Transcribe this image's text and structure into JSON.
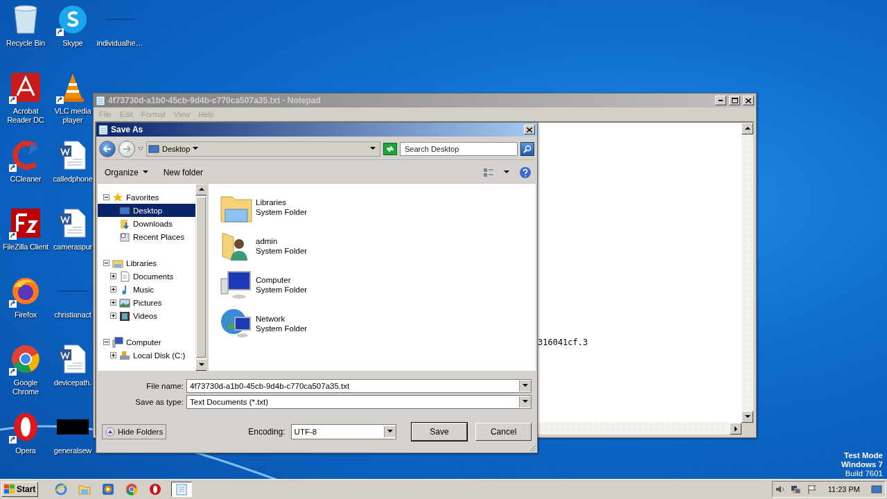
{
  "desktop_columns": [
    [
      {
        "label": "Recycle Bin",
        "kind": "recycle",
        "shortcut": false
      },
      {
        "label": "Acrobat Reader DC",
        "kind": "acrobat",
        "shortcut": true
      },
      {
        "label": "CCleaner",
        "kind": "ccleaner",
        "shortcut": true
      },
      {
        "label": "FileZilla Client",
        "kind": "filezilla",
        "shortcut": true
      },
      {
        "label": "Firefox",
        "kind": "firefox",
        "shortcut": true
      },
      {
        "label": "Google Chrome",
        "kind": "chrome",
        "shortcut": true
      },
      {
        "label": "Opera",
        "kind": "opera",
        "shortcut": true
      }
    ],
    [
      {
        "label": "Skype",
        "kind": "skype",
        "shortcut": true
      },
      {
        "label": "VLC media player",
        "kind": "vlc",
        "shortcut": true
      },
      {
        "label": "calledphone",
        "kind": "word",
        "shortcut": false
      },
      {
        "label": "cameraspur",
        "kind": "word",
        "shortcut": false
      },
      {
        "label": "christianact",
        "kind": "blank",
        "shortcut": false
      },
      {
        "label": "devicepath.",
        "kind": "word",
        "shortcut": false
      },
      {
        "label": "generalsew",
        "kind": "black",
        "shortcut": false
      }
    ],
    [
      {
        "label": "individualhe…",
        "kind": "blank",
        "shortcut": false
      }
    ]
  ],
  "notepad": {
    "title": "4f73730d-a1b0-45cb-9d4b-c770ca507a35.txt - Notepad",
    "menu": [
      "File",
      "Edit",
      "Format",
      "View",
      "Help"
    ],
    "text": "316041cf.3"
  },
  "save_dialog": {
    "title": "Save As",
    "address": "Desktop",
    "search": {
      "placeholder": "Search Desktop"
    },
    "toolbar": [
      "Organize",
      "New folder"
    ],
    "tree": [
      {
        "label": "Favorites",
        "kind": "star",
        "expanded": true,
        "selected": false,
        "children": [
          {
            "label": "Desktop",
            "kind": "desktop",
            "selected": true
          },
          {
            "label": "Downloads",
            "kind": "downloads",
            "selected": false
          },
          {
            "label": "Recent Places",
            "kind": "recent",
            "selected": false
          }
        ]
      },
      {
        "label": "Libraries",
        "kind": "library",
        "expanded": true,
        "selected": false,
        "children": [
          {
            "label": "Documents",
            "kind": "documents",
            "expanded": false,
            "selected": false
          },
          {
            "label": "Music",
            "kind": "music",
            "expanded": false,
            "selected": false
          },
          {
            "label": "Pictures",
            "kind": "pictures",
            "expanded": false,
            "selected": false
          },
          {
            "label": "Videos",
            "kind": "videos",
            "expanded": false,
            "selected": false
          }
        ]
      },
      {
        "label": "Computer",
        "kind": "computer",
        "expanded": true,
        "selected": false,
        "children": [
          {
            "label": "Local Disk (C:)",
            "kind": "disk",
            "expanded": false,
            "selected": false
          }
        ]
      }
    ],
    "items": [
      {
        "name": "Libraries",
        "type": "System Folder",
        "kind": "library"
      },
      {
        "name": "admin",
        "type": "System Folder",
        "kind": "user"
      },
      {
        "name": "Computer",
        "type": "System Folder",
        "kind": "computer"
      },
      {
        "name": "Network",
        "type": "System Folder",
        "kind": "network"
      }
    ],
    "file_name_label": "File name:",
    "file_name": "4f73730d-a1b0-45cb-9d4b-c770ca507a35.txt",
    "type_label": "Save as type:",
    "type": "Text Documents (*.txt)",
    "hide_folders": "Hide Folders",
    "encoding_label": "Encoding:",
    "encoding": "UTF-8",
    "buttons": [
      "Save",
      "Cancel"
    ]
  },
  "watermark_text": [
    "Test Mode",
    "Windows 7",
    "Build 7601"
  ],
  "taskbar": {
    "start": "Start",
    "apps": [
      {
        "kind": "ie",
        "selected": false
      },
      {
        "kind": "explorer",
        "selected": false
      },
      {
        "kind": "media",
        "selected": false
      },
      {
        "kind": "chrome",
        "selected": false
      },
      {
        "kind": "opera",
        "selected": false
      },
      {
        "kind": "notepad",
        "selected": true
      }
    ],
    "clock": "11:23 PM"
  }
}
